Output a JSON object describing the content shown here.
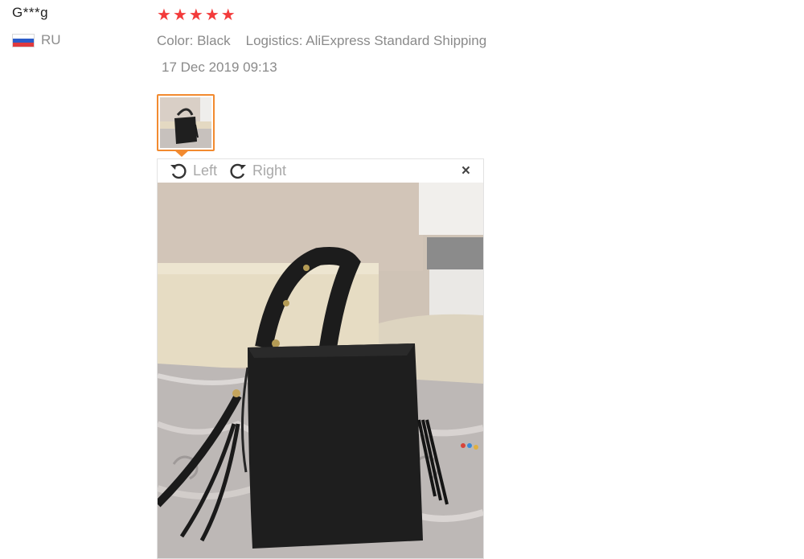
{
  "reviewer": {
    "name": "G***g",
    "country_code": "RU",
    "flag_colors": [
      "#ffffff",
      "#2b5cc9",
      "#e03a3e"
    ]
  },
  "review": {
    "rating": 5,
    "stars": [
      "★",
      "★",
      "★",
      "★",
      "★"
    ],
    "star_color": "#f33b3b",
    "color_text": "Color: Black",
    "logistics_text": "Logistics: AliExpress Standard Shipping",
    "date": "17 Dec 2019 09:13"
  },
  "viewer": {
    "rotate_left_label": "Left",
    "rotate_right_label": "Right",
    "close_symbol": "×",
    "accent_color": "#f28a2f"
  },
  "icons": {
    "rotate_left": "rotate-left-icon",
    "rotate_right": "rotate-right-icon",
    "close": "close-icon"
  }
}
